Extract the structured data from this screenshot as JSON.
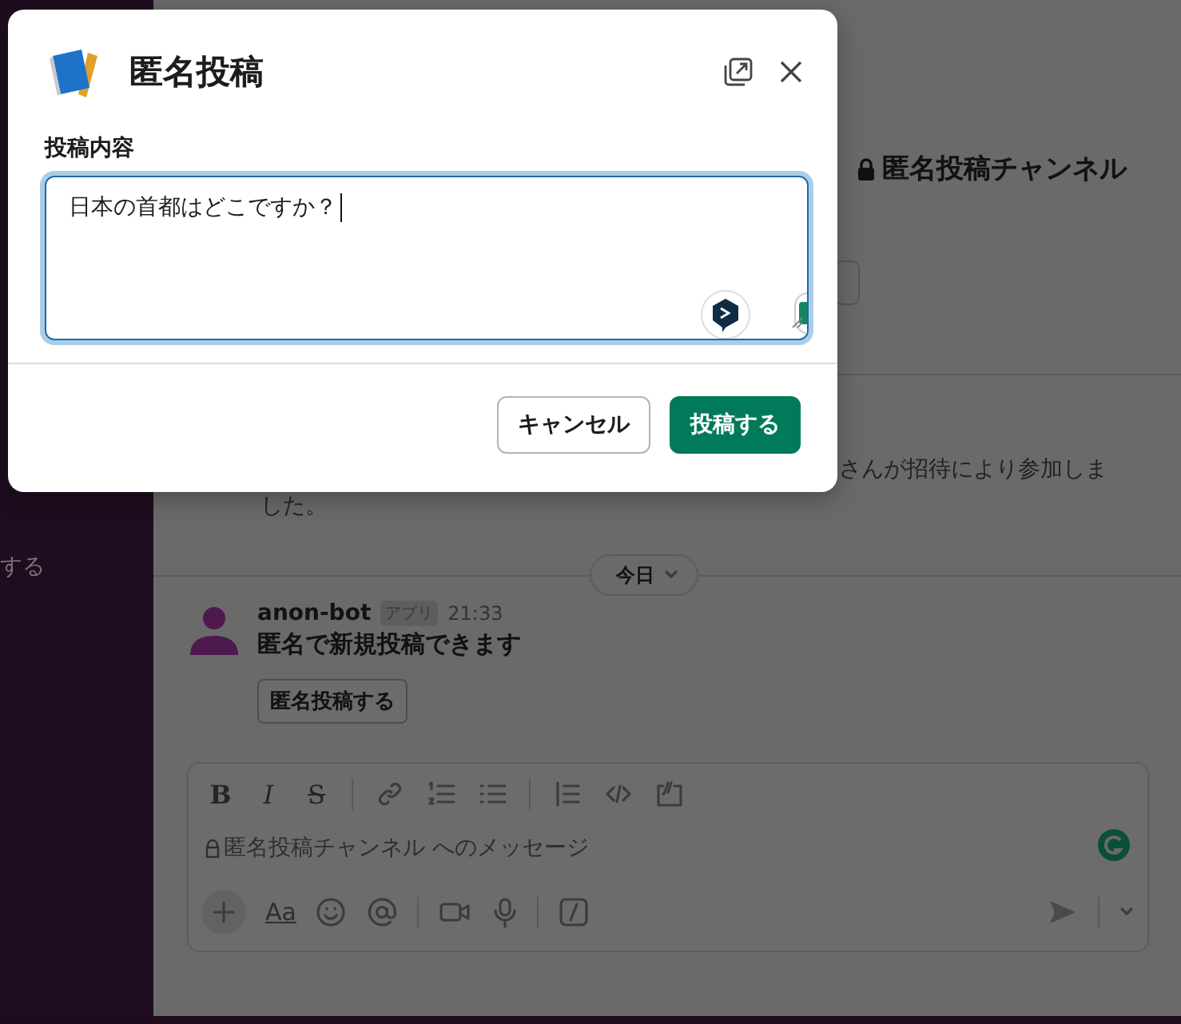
{
  "sidebar": {
    "items": [
      {
        "label": "する"
      }
    ]
  },
  "channel": {
    "title": "匿名投稿チャンネル",
    "system_message": [
      "さんが招待により参加しま",
      "した。"
    ],
    "date_divider": "今日"
  },
  "message": {
    "author": "anon-bot",
    "badge": "アプリ",
    "time": "21:33",
    "text": "匿名で新規投稿できます",
    "button": "匿名投稿する"
  },
  "composer": {
    "format_buttons": [
      "B",
      "I",
      "S"
    ],
    "placeholder": "匿名投稿チャンネル へのメッセージ",
    "text_button": "Aa"
  },
  "modal": {
    "title": "匿名投稿",
    "field_label": "投稿内容",
    "value": "日本の首都はどこですか？",
    "buttons": [
      {
        "kind": "secondary",
        "label": "キャンセル"
      },
      {
        "kind": "primary",
        "label": "投稿する"
      }
    ]
  }
}
